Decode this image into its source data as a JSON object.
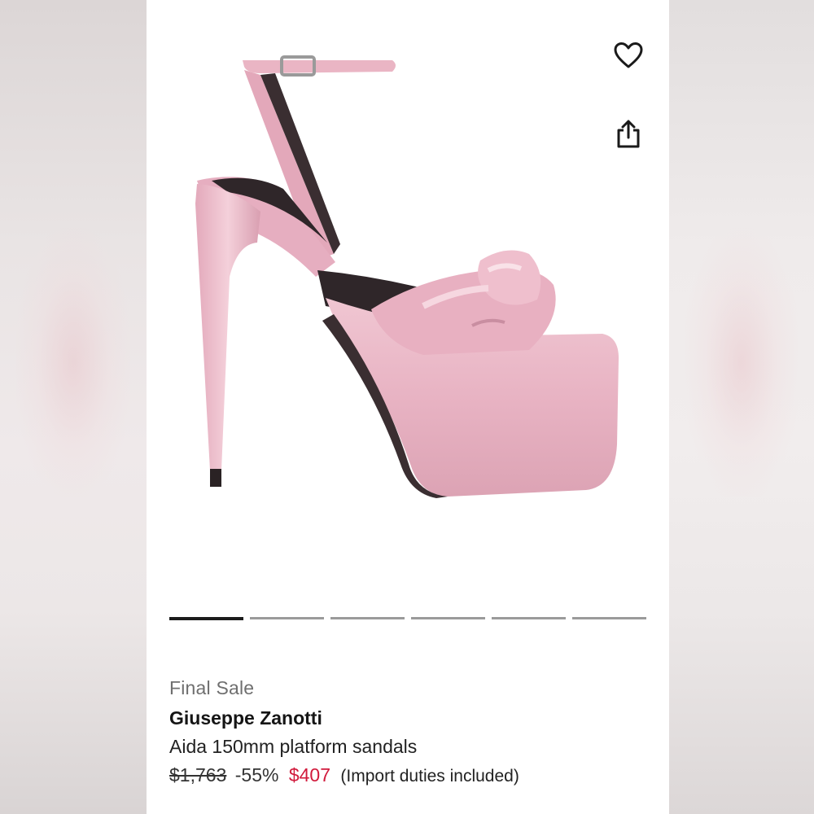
{
  "actions": {
    "favorite_icon": "heart-icon",
    "share_icon": "share-icon"
  },
  "gallery": {
    "image_count": 6,
    "active_index": 0
  },
  "product": {
    "sale_tag": "Final Sale",
    "brand": "Giuseppe Zanotti",
    "name": "Aida 150mm platform sandals",
    "original_price": "$1,763",
    "discount": "-55%",
    "sale_price": "$407",
    "price_note": "(Import duties included)"
  },
  "colors": {
    "sale_price": "#d11a3c",
    "shoe": "#e9b8c6",
    "pager_active": "#1b1b1b",
    "pager_inactive": "#9a9a9a"
  }
}
